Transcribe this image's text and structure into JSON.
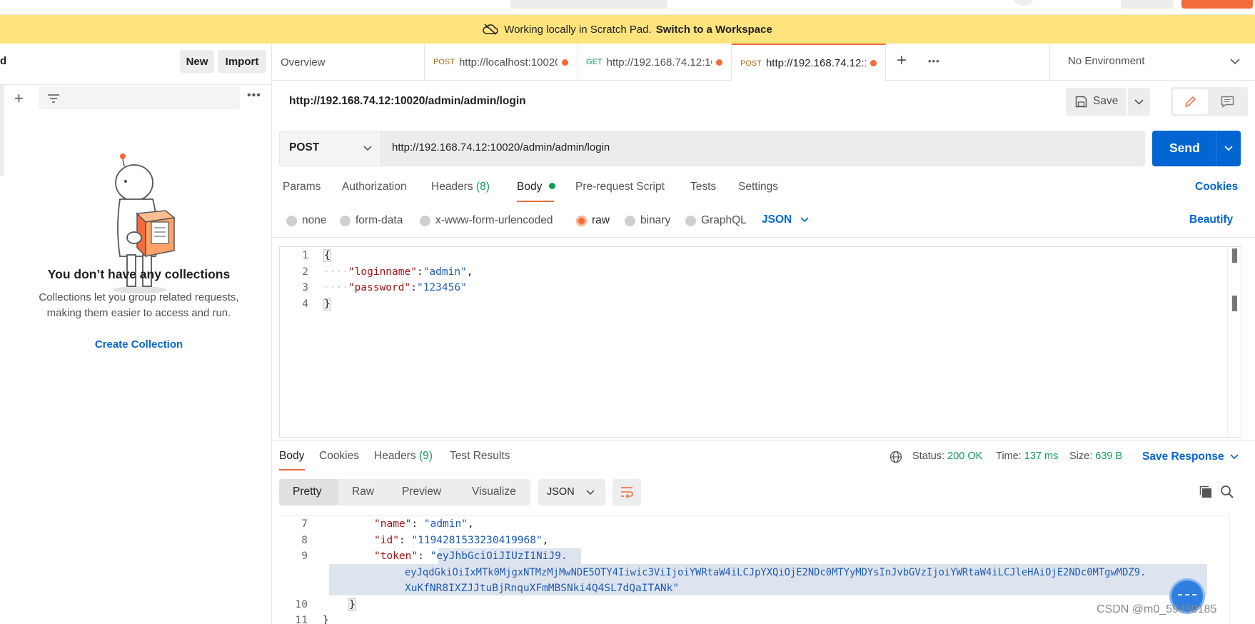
{
  "banner": {
    "text": "Working locally in Scratch Pad.",
    "link": "Switch to a Workspace"
  },
  "sidebar": {
    "header_fragment": "d",
    "new_label": "New",
    "import_label": "Import",
    "empty_title": "You don’t have any collections",
    "empty_desc_line1": "Collections let you group related requests,",
    "empty_desc_line2": "making them easier to access and run.",
    "create_label": "Create Collection"
  },
  "tabs": [
    {
      "label": "Overview"
    },
    {
      "method": "POST",
      "url": "http://localhost:10020"
    },
    {
      "method": "GET",
      "url": "http://192.168.74.12:100"
    },
    {
      "method": "POST",
      "url": "http://192.168.74.12:10"
    }
  ],
  "environment": "No Environment",
  "request": {
    "title": "http://192.168.74.12:10020/admin/admin/login",
    "method": "POST",
    "url": "http://192.168.74.12:10020/admin/admin/login",
    "save_label": "Save",
    "send_label": "Send",
    "cookies_label": "Cookies",
    "beautify_label": "Beautify"
  },
  "request_tabs": {
    "params": "Params",
    "authorization": "Authorization",
    "headers": "Headers",
    "headers_count": "(8)",
    "body": "Body",
    "prerequest": "Pre-request Script",
    "tests": "Tests",
    "settings": "Settings"
  },
  "body_types": {
    "none": "none",
    "form_data": "form-data",
    "urlencoded": "x-www-form-urlencoded",
    "raw": "raw",
    "binary": "binary",
    "graphql": "GraphQL",
    "format": "JSON",
    "selected": "raw"
  },
  "request_body": {
    "line_numbers": [
      "1",
      "2",
      "3",
      "4"
    ],
    "open": "{",
    "k1": "\"loginname\"",
    "v1": "\"admin\"",
    "k2": "\"password\"",
    "v2": "\"123456\"",
    "close": "}"
  },
  "response": {
    "tabs": {
      "body": "Body",
      "cookies": "Cookies",
      "headers": "Headers",
      "headers_count": "(9)",
      "tests": "Test Results"
    },
    "status_label": "Status:",
    "status_value": "200 OK",
    "time_label": "Time:",
    "time_value": "137 ms",
    "size_label": "Size:",
    "size_value": "639 B",
    "save_response": "Save Response",
    "views": {
      "pretty": "Pretty",
      "raw": "Raw",
      "preview": "Preview",
      "visualize": "Visualize"
    },
    "format": "JSON",
    "lines": {
      "ln7": "7",
      "ln8": "8",
      "ln9": "9",
      "ln10": "10",
      "ln11": "11",
      "name_key": "\"name\"",
      "name_val": "\"admin\"",
      "id_key": "\"id\"",
      "id_val": "\"1194281533230419968\"",
      "token_key": "\"token\"",
      "token_1": "\"eyJhbGciOiJIUzI1NiJ9.",
      "token_2": "eyJqdGkiOiIxMTk0MjgxNTMzMjMwNDE5OTY4Iiwic3ViIjoiYWRtaW4iLCJpYXQiOjE2NDc0MTYyMDYsInJvbGVzIjoiYWRtaW4iLCJleHAiOjE2NDc0MTgwMDZ9.",
      "token_3": "XuKfNR8IXZJJtuBjRnquXFmMBSNki4Q4SL7dQaITANk\"",
      "close_inner": "}",
      "close_outer": "}"
    }
  },
  "watermark": "CSDN @m0_59430185",
  "colors": {
    "accent": "#f26b3a",
    "send": "#0265d2",
    "banner": "#ffe47e",
    "status_ok": "#0f9d58",
    "link": "#0265d2"
  }
}
